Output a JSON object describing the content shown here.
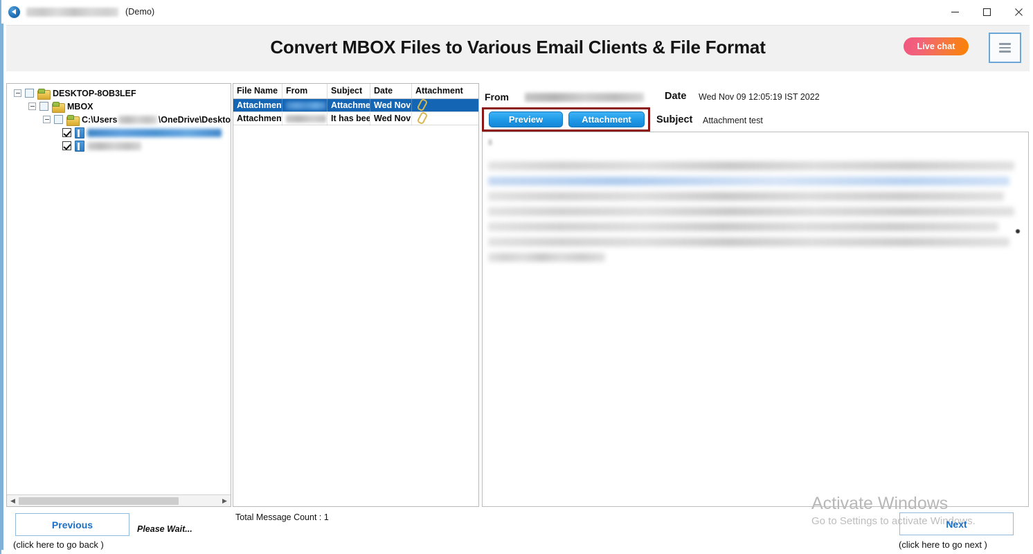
{
  "window": {
    "title_redacted": true,
    "title_suffix": "(Demo)",
    "app_icon": "back-circle-icon",
    "controls": {
      "minimize": "minimize-icon",
      "maximize": "maximize-icon",
      "close": "close-icon"
    }
  },
  "header": {
    "title": "Convert MBOX Files to Various Email Clients & File Format",
    "live_chat_label": "Live chat",
    "menu_icon": "hamburger-menu-icon",
    "accent_blue": "#6ba6d6",
    "live_chat_gradient_from": "#f2567f",
    "live_chat_gradient_to": "#fa8300"
  },
  "tree": {
    "nodes": [
      {
        "label": "DESKTOP-8OB3LEF",
        "level": 1,
        "expander": "minus",
        "checkbox": "unchecked",
        "icon": "folder-icon"
      },
      {
        "label": "MBOX",
        "level": 2,
        "expander": "minus",
        "checkbox": "unchecked",
        "icon": "folder-icon"
      },
      {
        "label": "C:\\Users",
        "label_tail": "\\OneDrive\\Deskto",
        "level": 3,
        "expander": "minus",
        "checkbox": "unchecked",
        "icon": "folder-icon",
        "redacted_middle": true
      },
      {
        "label": "",
        "level": 4,
        "checkbox": "checked",
        "icon": "file-icon",
        "redacted": true,
        "selected": true
      },
      {
        "label": "",
        "level": 4,
        "checkbox": "checked",
        "icon": "file-icon",
        "redacted": true,
        "selected": false
      }
    ],
    "scrollbar": {
      "left_arrow": "chevron-left-icon",
      "right_arrow": "chevron-right-icon",
      "thumb_percent": 80
    }
  },
  "message_list": {
    "columns": [
      "File Name",
      "From",
      "Subject",
      "Date",
      "Attachment"
    ],
    "rows": [
      {
        "file_name": "Attachment",
        "from": "",
        "from_redacted": true,
        "subject": "Attachmen",
        "date": "Wed Nov",
        "attachment": "paperclip-icon",
        "selected": true
      },
      {
        "file_name": "Attachment",
        "from": "",
        "from_redacted": true,
        "subject": "It has been",
        "date": "Wed Nov",
        "attachment": "paperclip-icon",
        "selected": false
      }
    ],
    "total_count_label": "Total Message Count : 1"
  },
  "preview": {
    "from_label": "From",
    "from_value_redacted": true,
    "date_label": "Date",
    "date_value": "Wed Nov 09 12:05:19 IST 2022",
    "subject_label": "Subject",
    "subject_value": "Attachment test",
    "tabs": [
      {
        "label": "Preview",
        "active": true
      },
      {
        "label": "Attachment",
        "active": false
      }
    ],
    "highlight_color": "#8c1515",
    "body_redacted": true
  },
  "footer": {
    "previous_label": "Previous",
    "previous_hint": "(click here to  go back )",
    "status_text": "Please Wait...",
    "next_label": "Next",
    "next_hint": "(click here to  go next )"
  },
  "watermark": {
    "line1": "Activate Windows",
    "line2": "Go to Settings to activate Windows."
  }
}
